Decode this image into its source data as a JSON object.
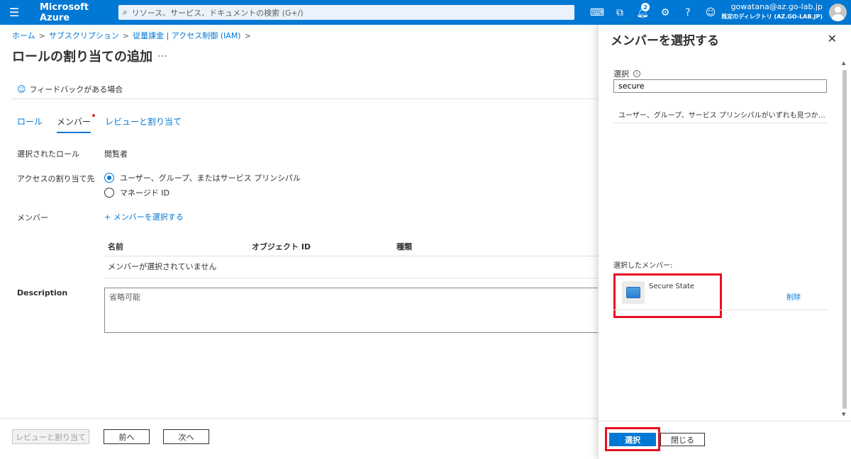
{
  "topbar": {
    "brand": "Microsoft Azure",
    "search_placeholder": "リソース、サービス、ドキュメントの検索 (G+/)",
    "notification_count": "2",
    "email": "gowatana@az.go-lab.jp",
    "directory": "既定のディレクトリ (AZ.GO-LAB.JP)"
  },
  "breadcrumb": {
    "items": [
      "ホーム",
      "サブスクリプション",
      "従量課金 | アクセス制御 (IAM)"
    ]
  },
  "page": {
    "title": "ロールの割り当ての追加",
    "more": "…",
    "feedback": "フィードバックがある場合"
  },
  "tabs": [
    "ロール",
    "メンバー",
    "レビューと割り当て"
  ],
  "form": {
    "selected_role_label": "選択されたロール",
    "selected_role_value": "閲覧者",
    "assign_to_label": "アクセスの割り当て先",
    "assign_option_1": "ユーザー、グループ、またはサービス プリンシパル",
    "assign_option_2": "マネージド ID",
    "members_label": "メンバー",
    "select_members_link": "+ メンバーを選択する",
    "table_headers": [
      "名前",
      "オブジェクト ID",
      "種類"
    ],
    "table_empty": "メンバーが選択されていません",
    "description_label": "Description",
    "description_placeholder": "省略可能"
  },
  "footer": {
    "review_button": "レビューと割り当て",
    "prev_button": "前へ",
    "next_button": "次へ"
  },
  "panel": {
    "title": "メンバーを選択する",
    "select_label": "選択",
    "search_value": "secure",
    "no_results": "ユーザー、グループ、サービス プリンシパルがいずれも見つかりませんでし...",
    "selected_members_label": "選択したメンバー:",
    "member_name": "Secure State",
    "delete_link": "削除",
    "select_button": "選択",
    "close_button": "閉じる"
  },
  "colors": {
    "azure_blue": "#0078d4",
    "highlight_red": "#e81123"
  }
}
